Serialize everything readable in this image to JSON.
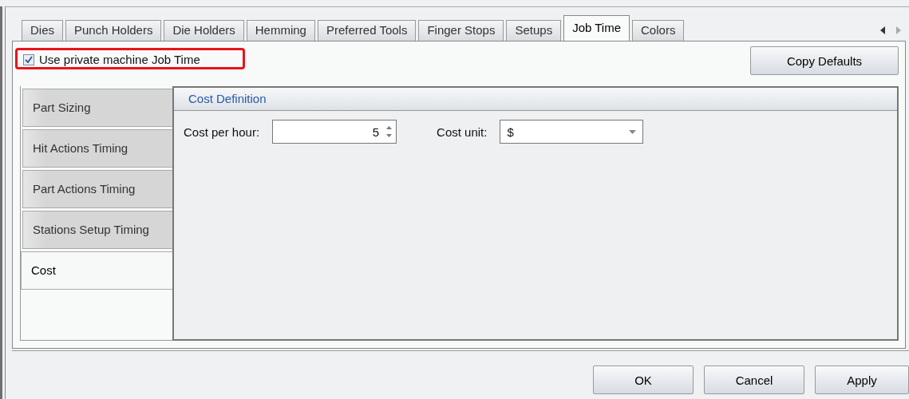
{
  "tabs": [
    {
      "label": "Dies",
      "selected": false
    },
    {
      "label": "Punch Holders",
      "selected": false
    },
    {
      "label": "Die Holders",
      "selected": false
    },
    {
      "label": "Hemming",
      "selected": false
    },
    {
      "label": "Preferred Tools",
      "selected": false
    },
    {
      "label": "Finger Stops",
      "selected": false
    },
    {
      "label": "Setups",
      "selected": false
    },
    {
      "label": "Job Time",
      "selected": true
    },
    {
      "label": "Colors",
      "selected": false
    }
  ],
  "use_private": {
    "label": "Use private machine Job Time",
    "checked": true,
    "highlighted": true
  },
  "copy_defaults": "Copy Defaults",
  "side_tabs": [
    {
      "label": "Part Sizing",
      "selected": false
    },
    {
      "label": "Hit Actions Timing",
      "selected": false
    },
    {
      "label": "Part Actions Timing",
      "selected": false
    },
    {
      "label": "Stations Setup Timing",
      "selected": false
    },
    {
      "label": "Cost",
      "selected": true
    }
  ],
  "group": {
    "title": "Cost Definition",
    "fields": [
      {
        "kind": "spin",
        "label": "Cost per hour:",
        "value": "5"
      },
      {
        "kind": "combo",
        "label": "Cost unit:",
        "value": "$"
      }
    ]
  },
  "buttons": [
    "OK",
    "Cancel",
    "Apply"
  ]
}
